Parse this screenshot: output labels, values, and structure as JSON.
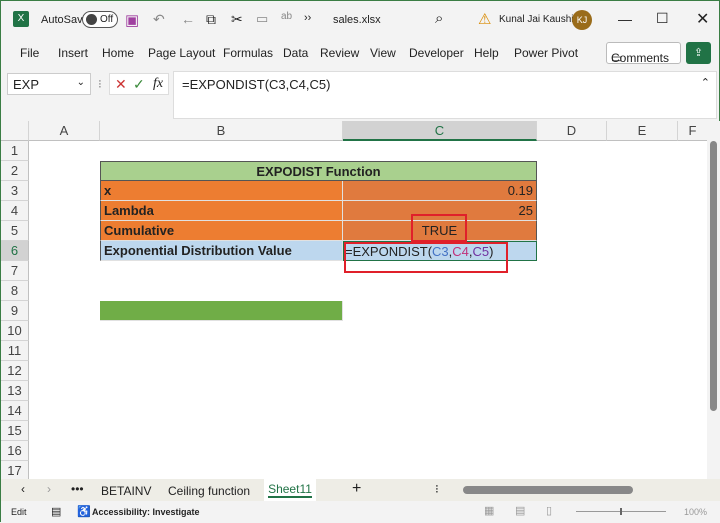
{
  "titlebar": {
    "autosave": "AutoSave",
    "toggle": "Off",
    "filename": "sales.xlsx",
    "user": "Kunal Jai Kaushik",
    "initials": "KJ"
  },
  "menu": [
    "File",
    "Insert",
    "Home",
    "Page Layout",
    "Formulas",
    "Data",
    "Review",
    "View",
    "Developer",
    "Help",
    "Power Pivot"
  ],
  "comments": "Comments",
  "namebox": "EXP",
  "formula": "=EXPONDIST(C3,C4,C5)",
  "columns": [
    "A",
    "B",
    "C",
    "D",
    "E",
    "F"
  ],
  "rows": [
    "1",
    "2",
    "3",
    "4",
    "5",
    "6",
    "7",
    "8",
    "9",
    "10",
    "11",
    "12",
    "13",
    "14",
    "15",
    "16",
    "17"
  ],
  "table": {
    "title": "EXPODIST Function",
    "labels": [
      "x",
      "Lambda",
      "Cumulative",
      "Exponential Distribution Value"
    ],
    "values": [
      "0.19",
      "25",
      "TRUE"
    ],
    "formula_parts": [
      "=EXPONDIST(",
      "C3",
      ",",
      "C4",
      ",",
      "C5",
      ")"
    ]
  },
  "tabs": [
    "BETAINV",
    "Ceiling function",
    "Sheet11"
  ],
  "status": {
    "mode": "Edit",
    "accessibility": "Accessibility: Investigate",
    "zoom": "100%"
  },
  "colors": {
    "header_green": "#a9d08e",
    "orange": "#ed7d31",
    "selected_blue": "#bdd7ee",
    "green_bar": "#70ad47",
    "excel_green": "#217346"
  }
}
